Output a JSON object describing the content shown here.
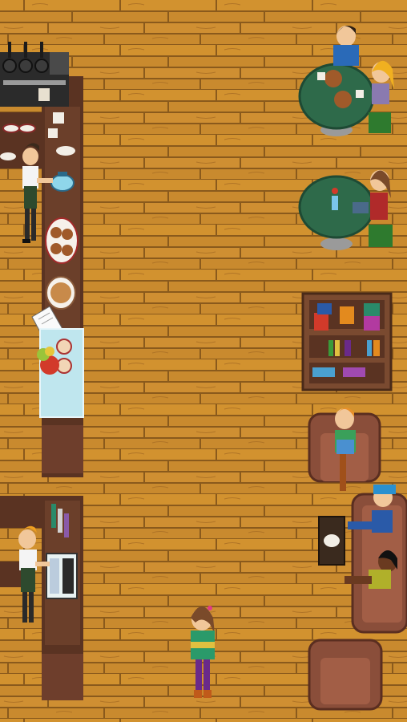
{
  "scene": {
    "type": "pixel-art cafe interior, top-down view",
    "colors": {
      "floor": "#c98a2e",
      "floor_light": "#d99a3c",
      "floor_line": "#8a5a1c",
      "counter": "#5a3322",
      "counter_top": "#6b3f2a",
      "table": "#2e6a4a",
      "armchair": "#8a4e3a",
      "bookshelf": "#7a4a30",
      "glass_case": "#bfe6ee"
    },
    "book_colors": [
      "#d23a2a",
      "#e38a1e",
      "#2a8a6a",
      "#b23aa0",
      "#2a5aa8",
      "#e0c040",
      "#3a9a3a",
      "#6a2a8a",
      "#4aa0d0",
      "#a04ab0"
    ]
  }
}
